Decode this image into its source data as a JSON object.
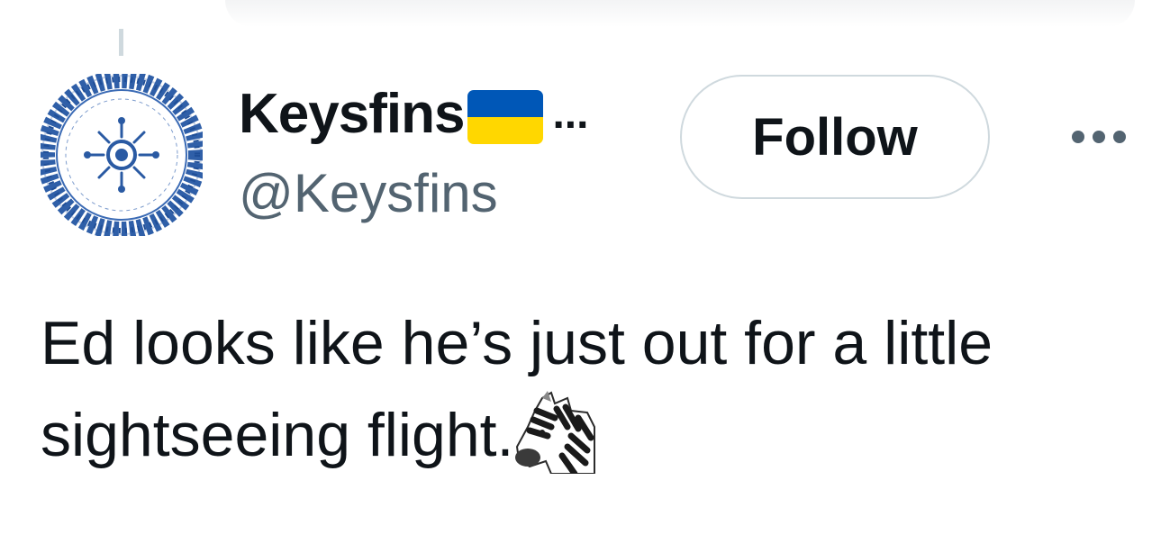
{
  "tweet": {
    "author": {
      "display_name": "Keysfins",
      "display_name_ellipsis": "...",
      "handle": "@Keysfins",
      "avatar_icon": "blue-white-porcelain-plate",
      "flag_icon": "ukraine-flag-icon"
    },
    "follow_label": "Follow",
    "more_icon": "more-horizontal-icon",
    "text_lines": [
      "Ed looks like he’s just out for a little",
      "sightseeing flight."
    ],
    "emoji_icon": "zebra-emoji"
  },
  "colors": {
    "text_primary": "#0f1419",
    "text_secondary": "#536471",
    "border": "#cfd9de",
    "flag_blue": "#0057b7",
    "flag_yellow": "#ffd700"
  }
}
